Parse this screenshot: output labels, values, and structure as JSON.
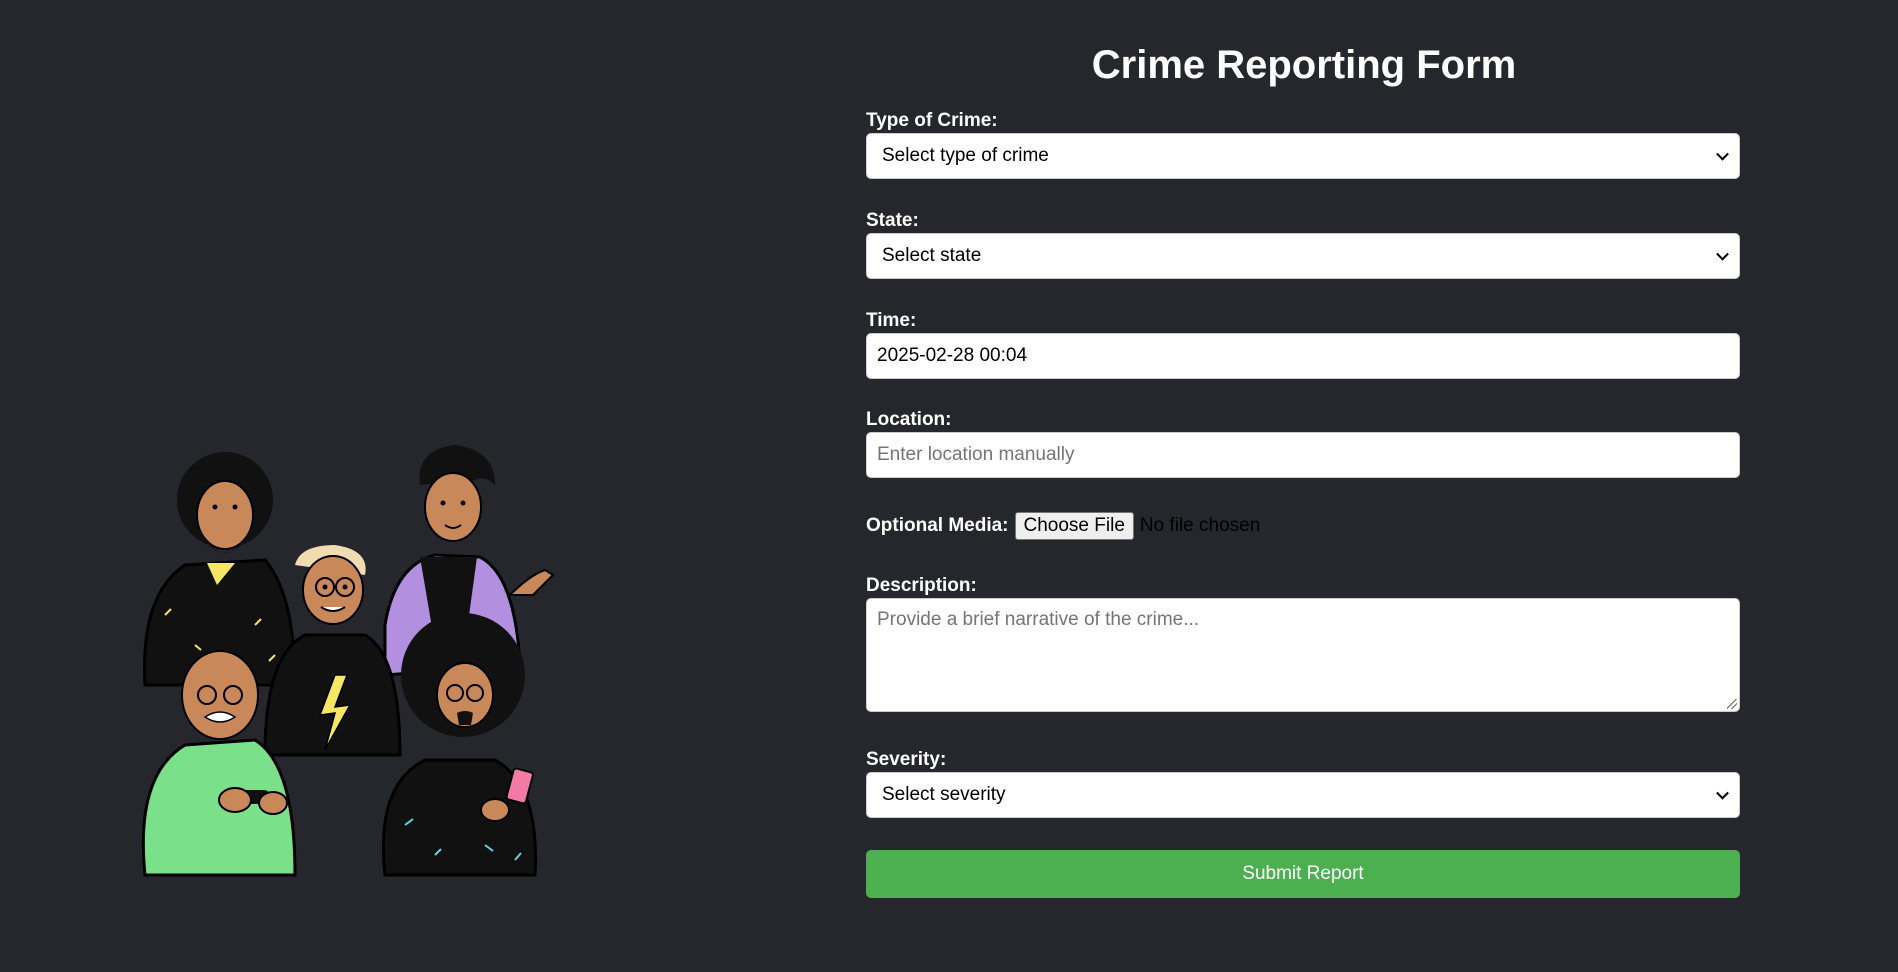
{
  "form": {
    "title": "Crime Reporting Form",
    "crime_type": {
      "label": "Type of Crime:",
      "selected": "Select type of crime"
    },
    "state": {
      "label": "State:",
      "selected": "Select state"
    },
    "time": {
      "label": "Time:",
      "value": "2025-02-28 00:04"
    },
    "location": {
      "label": "Location:",
      "placeholder": "Enter location manually"
    },
    "media": {
      "label": "Optional Media:",
      "button": "Choose File",
      "status": "No file chosen"
    },
    "description": {
      "label": "Description:",
      "placeholder": "Provide a brief narrative of the crime..."
    },
    "severity": {
      "label": "Severity:",
      "selected": "Select severity"
    },
    "submit_label": "Submit Report"
  },
  "colors": {
    "background": "#26262d",
    "submit": "#4caf50",
    "text": "#ffffff"
  },
  "illustration": {
    "icon": "group-of-people-illustration"
  }
}
